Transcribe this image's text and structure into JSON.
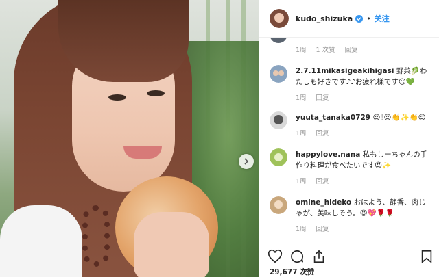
{
  "post": {
    "next_icon": "chevron-right-icon"
  },
  "header": {
    "username": "kudo_shizuka",
    "verified_icon": "verified-badge-icon",
    "follow_label": "关注",
    "separator": "•"
  },
  "comments": [
    {
      "user": "",
      "text": "",
      "time": "1周",
      "likes": "1 次赞",
      "reply": "回复"
    },
    {
      "user": "2.7.11mikasigeakihigasi",
      "text": "野菜🥬わたしも好きです♪♪お疲れ様です☺💚",
      "time": "1周",
      "likes": "",
      "reply": "回复"
    },
    {
      "user": "yuuta_tanaka0729",
      "text": "😍‼😍👏✨👏😍",
      "time": "1周",
      "likes": "",
      "reply": "回复"
    },
    {
      "user": "happylove.nana",
      "text": "私もしーちゃんの手作り料理が食べたいです😍✨",
      "time": "1周",
      "likes": "",
      "reply": "回复"
    },
    {
      "user": "omine_hideko",
      "text": "おはよう、静香、肉じゃが、美味しそう。☺💖🌹🌹",
      "time": "1周",
      "likes": "",
      "reply": "回复"
    }
  ],
  "actions": {
    "like_icon": "heart-icon",
    "comment_icon": "comment-icon",
    "share_icon": "share-icon",
    "save_icon": "bookmark-icon",
    "likes_count": "29,677 次赞"
  },
  "colors": {
    "link": "#3897f0",
    "muted": "#999999",
    "text": "#262626"
  }
}
